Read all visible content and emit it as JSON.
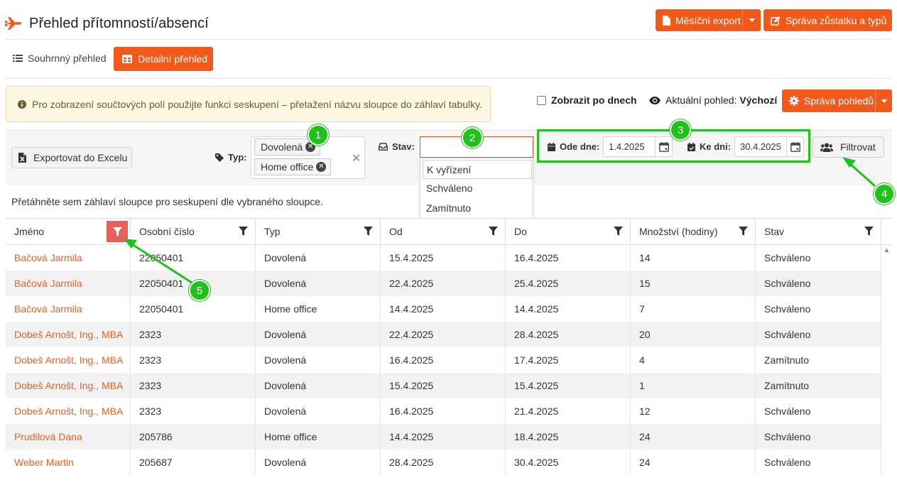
{
  "header": {
    "title": "Přehled přítomností/absencí",
    "monthly_export_label": "Měsíční export",
    "manage_balance_label": "Správa zůstatku a typů"
  },
  "tabs": {
    "summary_label": "Souhrnný přehled",
    "detail_label": "Detailní přehled"
  },
  "info": {
    "text": "Pro zobrazení součtových polí použijte funkci seskupení – přetažení názvu sloupce do záhlaví tabulky."
  },
  "options": {
    "show_by_days_label": "Zobrazit po dnech",
    "show_by_days_checked": false,
    "current_view_label": "Aktuální pohled:",
    "current_view_value": "Výchozí",
    "manage_views_label": "Správa pohledů"
  },
  "filters": {
    "export_excel_label": "Exportovat do Excelu",
    "type_label": "Typ:",
    "type_chips": [
      "Dovolená",
      "Home office"
    ],
    "state_label": "Stav:",
    "state_value": "",
    "state_options": [
      "K vyřízení",
      "Schváleno",
      "Zamítnuto"
    ],
    "from_label": "Ode dne:",
    "from_value": "1.4.2025",
    "to_label": "Ke dni:",
    "to_value": "30.4.2025",
    "filter_button_label": "Filtrovat"
  },
  "grid": {
    "group_hint": "Přetáhněte sem záhlaví sloupce pro seskupení dle vybraného sloupce.",
    "columns": [
      "Jméno",
      "Osobní číslo",
      "Typ",
      "Od",
      "Do",
      "Množství (hodiny)",
      "Stav"
    ],
    "rows": [
      [
        "Bačová Jarmila",
        "22050401",
        "Dovolená",
        "15.4.2025",
        "16.4.2025",
        "14",
        "Schváleno"
      ],
      [
        "Bačová Jarmila",
        "22050401",
        "Dovolená",
        "22.4.2025",
        "25.4.2025",
        "15",
        "Schváleno"
      ],
      [
        "Bačová Jarmila",
        "22050401",
        "Home office",
        "14.4.2025",
        "14.4.2025",
        "7",
        "Schváleno"
      ],
      [
        "Dobeš Arnošt, Ing., MBA",
        "2323",
        "Dovolená",
        "22.4.2025",
        "28.4.2025",
        "20",
        "Schváleno"
      ],
      [
        "Dobeš Arnošt, Ing., MBA",
        "2323",
        "Dovolená",
        "16.4.2025",
        "17.4.2025",
        "4",
        "Zamítnuto"
      ],
      [
        "Dobeš Arnošt, Ing., MBA",
        "2323",
        "Dovolená",
        "15.4.2025",
        "15.4.2025",
        "1",
        "Zamítnuto"
      ],
      [
        "Dobeš Arnošt, Ing., MBA",
        "2323",
        "Dovolená",
        "16.4.2025",
        "21.4.2025",
        "12",
        "Schváleno"
      ],
      [
        "Prudilová Dana",
        "205786",
        "Home office",
        "14.4.2025",
        "18.4.2025",
        "24",
        "Schváleno"
      ],
      [
        "Weber Martin",
        "205687",
        "Dovolená",
        "28.4.2025",
        "30.4.2025",
        "24",
        "Schváleno"
      ]
    ]
  },
  "annotations": [
    "1",
    "2",
    "3",
    "4",
    "5"
  ],
  "colors": {
    "accent": "#f25a1c",
    "name_link": "#e8601f",
    "annotation_green": "#1fc21a",
    "active_filter": "#e9605a"
  },
  "icons": {
    "title": "plane-icon",
    "export": "file-icon",
    "manage_balance": "edit-icon",
    "summary_tab": "list-icon",
    "detail_tab": "table-icon",
    "info": "info-circle-icon",
    "current_view": "eye-icon",
    "manage_views": "gear-icon",
    "excel": "excel-file-icon",
    "type": "tag-icon",
    "state": "inbox-icon",
    "from_date": "calendar-icon",
    "to_date": "calendar-check-icon",
    "filter_button": "users-icon",
    "column_filter": "funnel-icon"
  }
}
